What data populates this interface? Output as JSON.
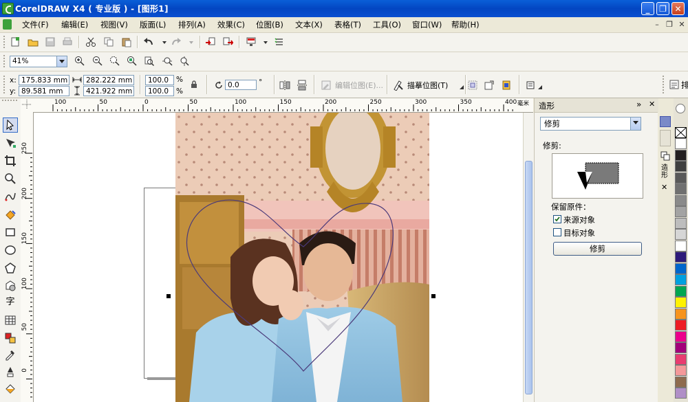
{
  "window": {
    "title": "CorelDRAW X4 ( 专业版 ) - [图形1]"
  },
  "menu": {
    "items": [
      "文件(F)",
      "编辑(E)",
      "视图(V)",
      "版面(L)",
      "排列(A)",
      "效果(C)",
      "位图(B)",
      "文本(X)",
      "表格(T)",
      "工具(O)",
      "窗口(W)",
      "帮助(H)"
    ]
  },
  "zoom": {
    "value": "41%"
  },
  "property_bar": {
    "x_label": "x:",
    "x": "175.833 mm",
    "y_label": "y:",
    "y": "89.581 mm",
    "w": "282.222 mm",
    "h": "421.922 mm",
    "scale_w": "100.0",
    "scale_h": "100.0",
    "percent": "%",
    "rotation": "0.0",
    "degree": "°",
    "edit_bitmap": "编辑位图(E)...",
    "trace_bitmap": "描摹位图(T)",
    "right_cut": "排"
  },
  "ruler": {
    "h_ticks": [
      "100",
      "50",
      "0",
      "50",
      "100",
      "150",
      "200",
      "250",
      "300",
      "350",
      "400"
    ],
    "h_unit": "毫米",
    "v_ticks": [
      "250",
      "200",
      "150",
      "100",
      "50",
      "0"
    ]
  },
  "docker": {
    "title": "造形",
    "mode": "修剪",
    "section_label": "修剪:",
    "keep_label": "保留原件：",
    "source": {
      "label": "来源对象",
      "checked": true
    },
    "target": {
      "label": "目标对象",
      "checked": false
    },
    "apply_button": "修剪",
    "tab_label": "造形"
  },
  "colors": {
    "palette": [
      "#ffffff",
      "#231f20",
      "#3f3f3f",
      "#595959",
      "#707070",
      "#8a8a8a",
      "#a3a3a3",
      "#bdbdbd",
      "#d6d6d6",
      "#ffffff",
      "#2d1a7a",
      "#0066cc",
      "#00a0e0",
      "#00a651",
      "#fff200",
      "#f7941d",
      "#ed1c24",
      "#ec008c",
      "#a3007a",
      "#e83c70",
      "#f4999a",
      "#8e6b4e",
      "#b08fc7"
    ],
    "accent": "#0a4fd0"
  }
}
